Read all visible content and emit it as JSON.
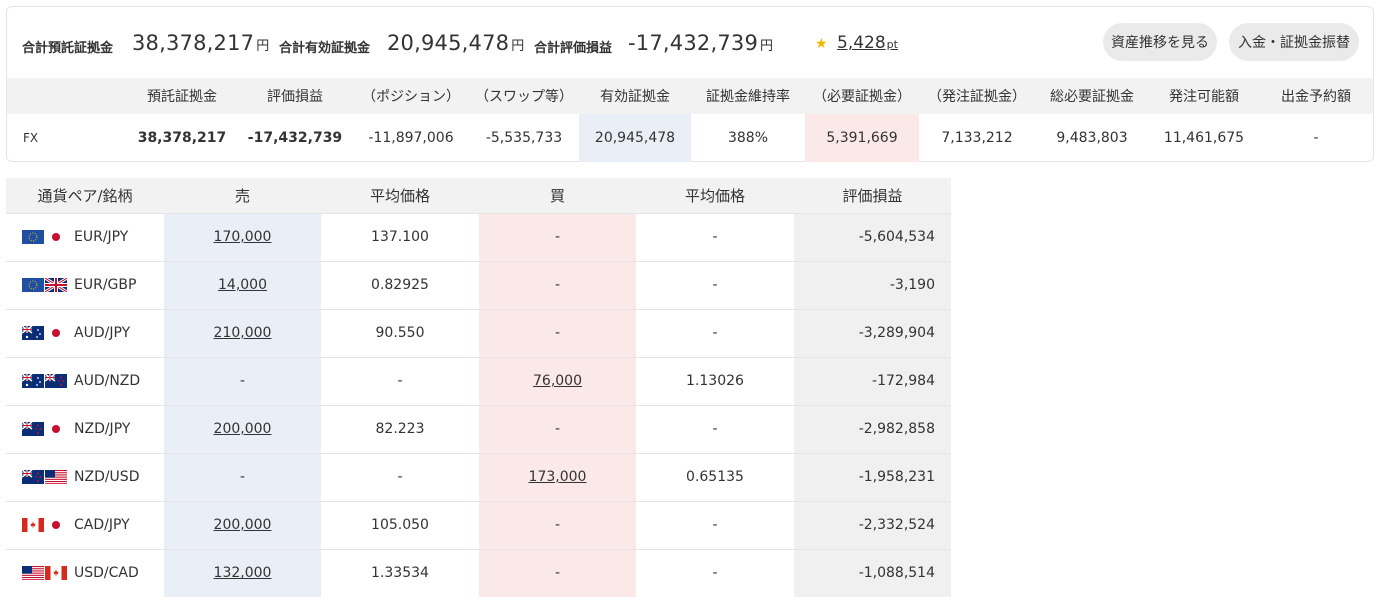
{
  "summary": {
    "deposit_label": "合計預託証拠金",
    "deposit_value": "38,378,217",
    "effective_label": "合計有効証拠金",
    "effective_value": "20,945,478",
    "pnl_label": "合計評価損益",
    "pnl_value": "-17,432,739",
    "unit": "円",
    "points": "5,428",
    "points_unit": "pt"
  },
  "buttons": {
    "asset_history": "資産推移を見る",
    "transfer": "入金・証拠金振替"
  },
  "account_table": {
    "headers": [
      "",
      "預託証拠金",
      "評価損益",
      "（ポジション）",
      "（スワップ等）",
      "有効証拠金",
      "証拠金維持率",
      "（必要証拠金）",
      "（発注証拠金）",
      "総必要証拠金",
      "発注可能額",
      "出金予約額"
    ],
    "row": [
      "FX",
      "38,378,217",
      "-17,432,739",
      "-11,897,006",
      "-5,535,733",
      "20,945,478",
      "388%",
      "5,391,669",
      "7,133,212",
      "9,483,803",
      "11,461,675",
      "-"
    ]
  },
  "positions": {
    "headers": [
      "通貨ペア/銘柄",
      "売",
      "平均価格",
      "買",
      "平均価格",
      "評価損益"
    ],
    "rows": [
      {
        "pair": "EUR/JPY",
        "flags": [
          "eu",
          "jp"
        ],
        "sell": "170,000",
        "sell_avg": "137.100",
        "buy": "-",
        "buy_avg": "-",
        "pnl": "-5,604,534"
      },
      {
        "pair": "EUR/GBP",
        "flags": [
          "eu",
          "gb"
        ],
        "sell": "14,000",
        "sell_avg": "0.82925",
        "buy": "-",
        "buy_avg": "-",
        "pnl": "-3,190"
      },
      {
        "pair": "AUD/JPY",
        "flags": [
          "au",
          "jp"
        ],
        "sell": "210,000",
        "sell_avg": "90.550",
        "buy": "-",
        "buy_avg": "-",
        "pnl": "-3,289,904"
      },
      {
        "pair": "AUD/NZD",
        "flags": [
          "au",
          "nz"
        ],
        "sell": "-",
        "sell_avg": "-",
        "buy": "76,000",
        "buy_avg": "1.13026",
        "pnl": "-172,984"
      },
      {
        "pair": "NZD/JPY",
        "flags": [
          "nz",
          "jp"
        ],
        "sell": "200,000",
        "sell_avg": "82.223",
        "buy": "-",
        "buy_avg": "-",
        "pnl": "-2,982,858"
      },
      {
        "pair": "NZD/USD",
        "flags": [
          "nz",
          "us"
        ],
        "sell": "-",
        "sell_avg": "-",
        "buy": "173,000",
        "buy_avg": "0.65135",
        "pnl": "-1,958,231"
      },
      {
        "pair": "CAD/JPY",
        "flags": [
          "ca",
          "jp"
        ],
        "sell": "200,000",
        "sell_avg": "105.050",
        "buy": "-",
        "buy_avg": "-",
        "pnl": "-2,332,524"
      },
      {
        "pair": "USD/CAD",
        "flags": [
          "us",
          "ca"
        ],
        "sell": "132,000",
        "sell_avg": "1.33534",
        "buy": "-",
        "buy_avg": "-",
        "pnl": "-1,088,514"
      }
    ]
  },
  "colors": {
    "sell_bg": "#eaeff7",
    "buy_bg": "#fbe9ea",
    "header_bg": "#f2f2f2",
    "star": "#f0b800"
  }
}
